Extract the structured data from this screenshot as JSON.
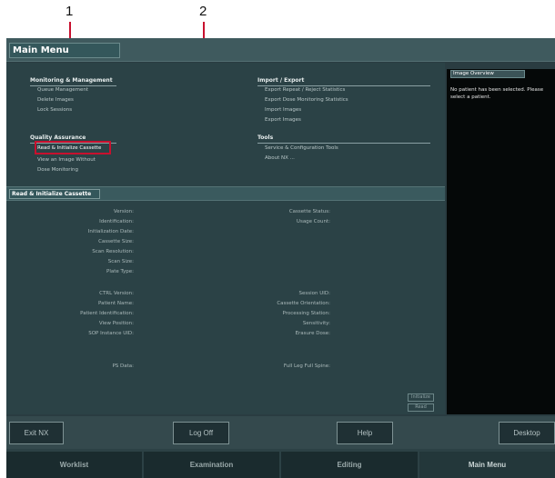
{
  "callouts": {
    "one": "1",
    "two": "2"
  },
  "window": {
    "title": "Main Menu"
  },
  "menu": {
    "monitoring": {
      "title": "Monitoring & Management",
      "items": [
        "Queue Management",
        "Delete Images",
        "Lock Sessions"
      ]
    },
    "quality": {
      "title": "Quality Assurance",
      "items": [
        "Read & Initialize Cassette",
        "View an Image Without",
        "Dose Monitoring"
      ]
    },
    "import_export": {
      "title": "Import / Export",
      "items": [
        "Export Repeat / Reject Statistics",
        "Export Dose Monitoring Statistics",
        "Import Images",
        "Export Images"
      ]
    },
    "tools": {
      "title": "Tools",
      "items": [
        "Service & Configuration Tools",
        "About NX ..."
      ]
    }
  },
  "cassette": {
    "title": "Read & Initialize Cassette",
    "left_labels": [
      "Version:",
      "Identification:",
      "Initialization Date:",
      "Cassette Size:",
      "Scan Resolution:",
      "Scan Size:",
      "Plate Type:",
      "CTRL Version:",
      "Patient Name:",
      "Patient Identification:",
      "View Position:",
      "SOP Instance UID:",
      "PS Data:"
    ],
    "right_labels": [
      "Cassette Status:",
      "Usage Count:",
      "Session UID:",
      "Cassette Orientation:",
      "Processing Station:",
      "Sensitivity:",
      "Erasure Dose:",
      "Full Leg Full Spine:"
    ],
    "initialize_button": "Initialize",
    "read_button": "Read"
  },
  "overview": {
    "title": "Image Overview",
    "message": "No patient has been selected. Please select a patient."
  },
  "buttons": {
    "exit": "Exit NX",
    "logoff": "Log Off",
    "help": "Help",
    "desktop": "Desktop"
  },
  "nav": {
    "worklist": "Worklist",
    "examination": "Examination",
    "editing": "Editing",
    "main_menu": "Main Menu"
  },
  "colors": {
    "highlight": "#c8102e",
    "panel": "#2b4246",
    "overview_bg": "#050808"
  }
}
